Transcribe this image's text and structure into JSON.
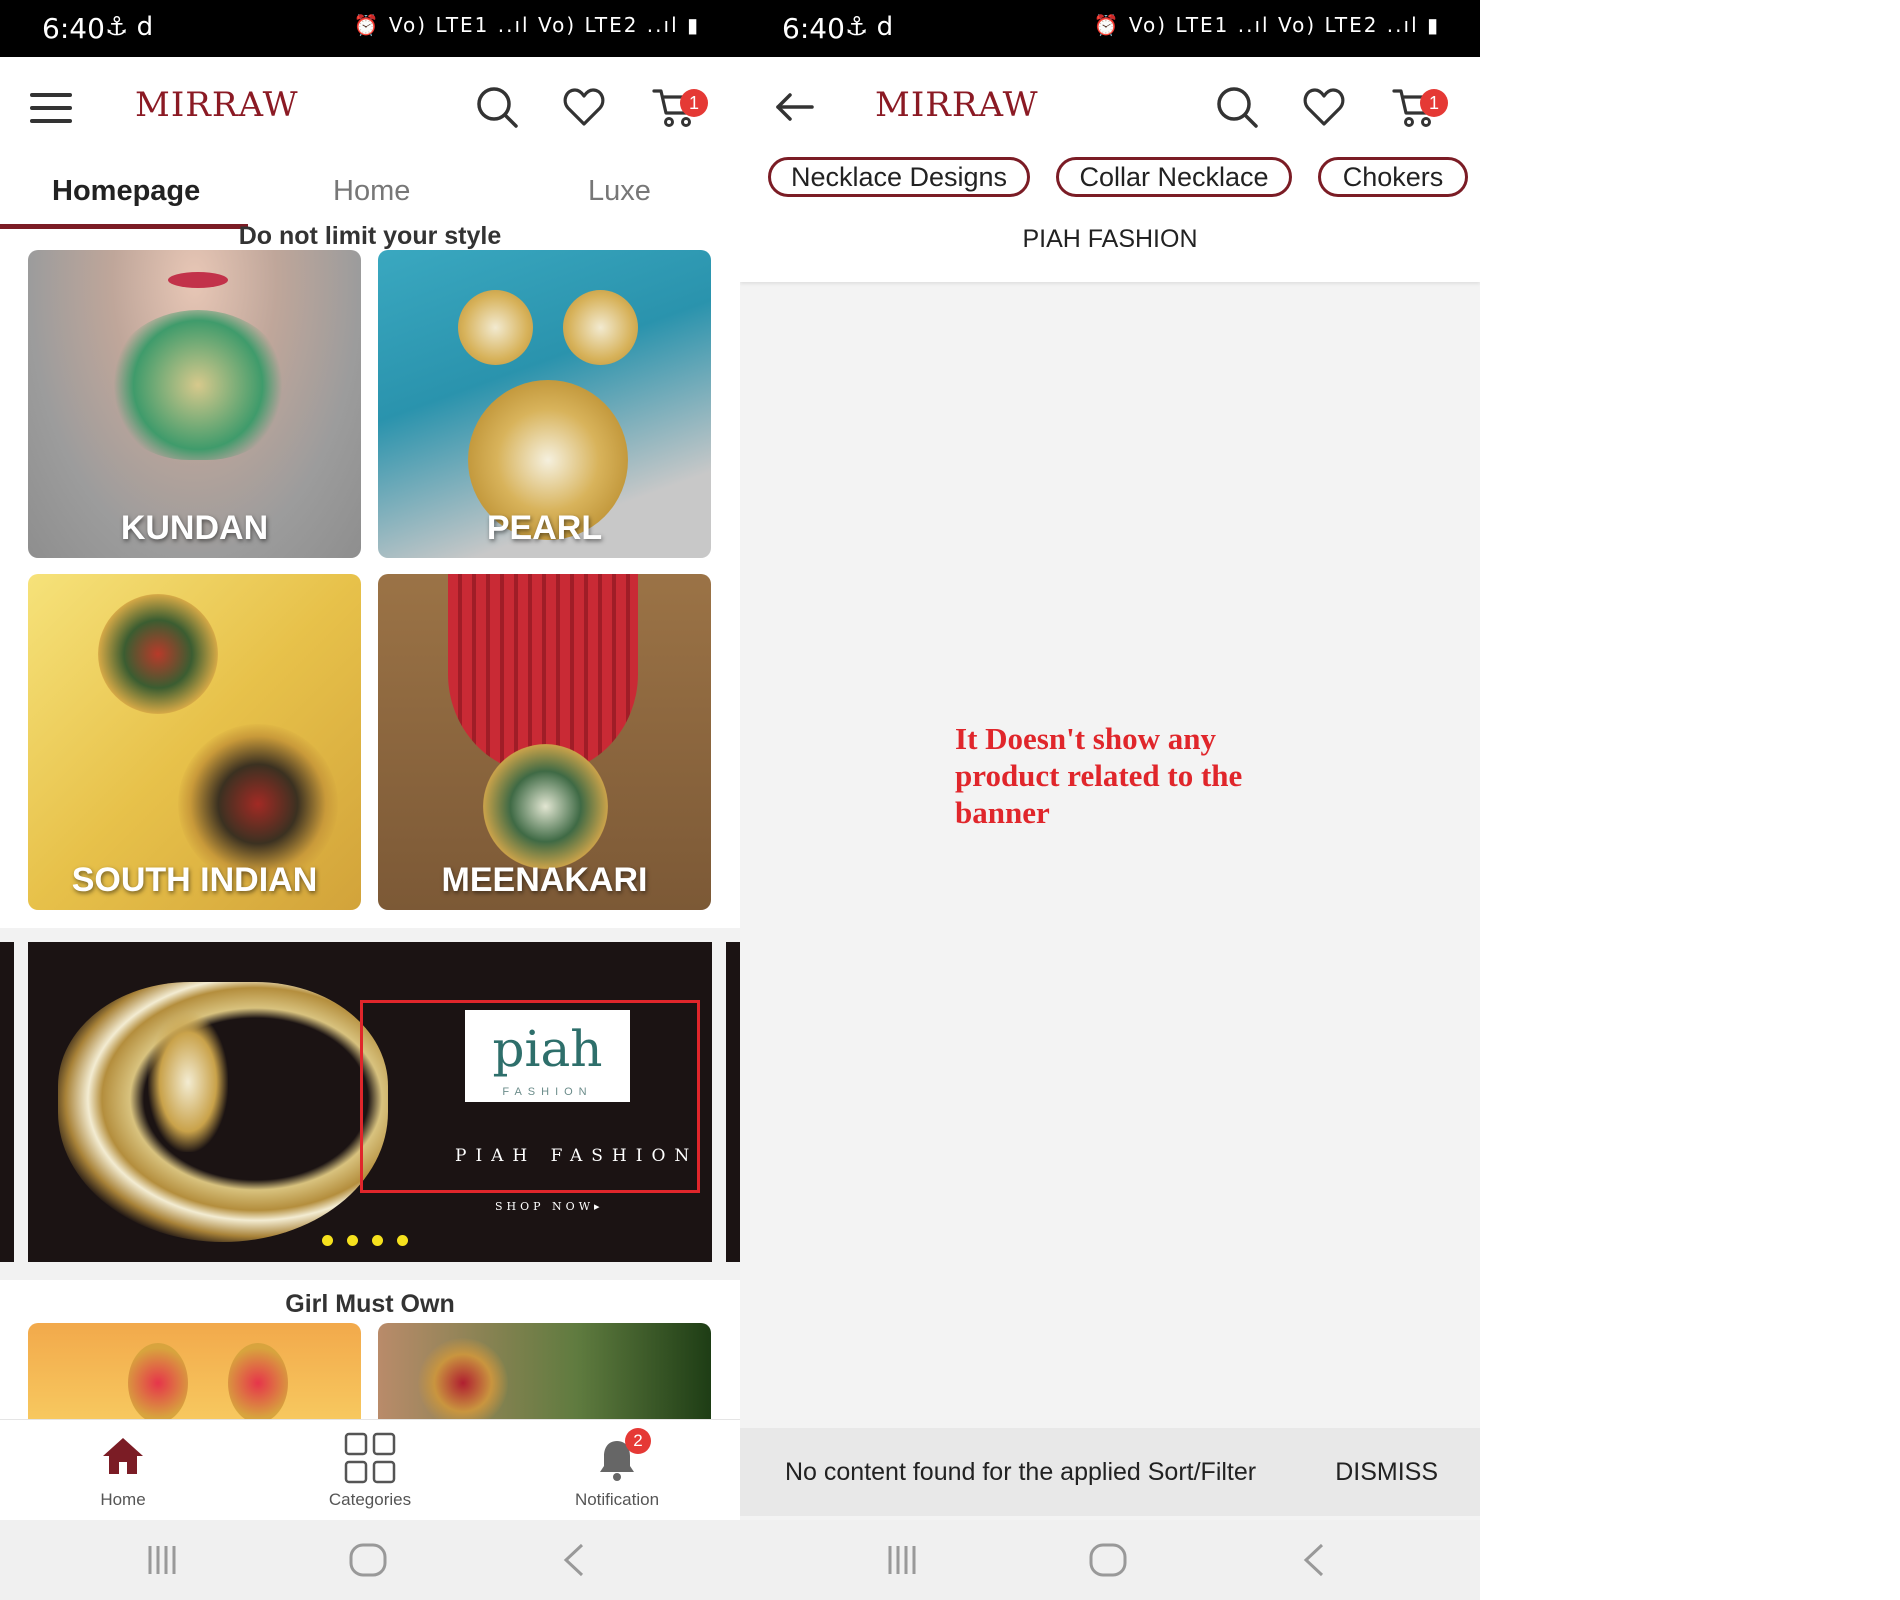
{
  "status_bar": {
    "time": "6:40",
    "left_icons": "⚓ d",
    "right_icons": "⏰ Vo) LTE1 ..ıl Vo) LTE2 ..ıl ▮"
  },
  "left": {
    "brand": "MIRRAW",
    "cart_count": "1",
    "tabs": [
      "Homepage",
      "Home",
      "Luxe"
    ],
    "active_tab": "Homepage",
    "section1_title": "Do not limit your style",
    "tiles": [
      "KUNDAN",
      "PEARL",
      "SOUTH INDIAN",
      "MEENAKARI"
    ],
    "banner": {
      "logo_text": "piah",
      "logo_sub": "FASHION",
      "title": "PIAH FASHION",
      "cta": "SHOP NOW▸",
      "dots": 4
    },
    "section2_title": "Girl Must Own",
    "bottom_nav": [
      {
        "label": "Home",
        "icon": "home-icon"
      },
      {
        "label": "Categories",
        "icon": "grid-icon"
      },
      {
        "label": "Notification",
        "icon": "bell-icon",
        "badge": "2"
      }
    ]
  },
  "right": {
    "brand": "MIRRAW",
    "cart_count": "1",
    "chips": [
      "Necklace Designs",
      "Collar Necklace",
      "Chokers"
    ],
    "page_title": "PIAH FASHION",
    "annotation": "It Doesn't show any product related to the banner",
    "snackbar_message": "No content found for the applied Sort/Filter",
    "snackbar_action": "DISMISS"
  },
  "colors": {
    "brand": "#8b1a24",
    "accent": "#7b1c25",
    "badge": "#e53935",
    "annotation": "#e0262b"
  }
}
